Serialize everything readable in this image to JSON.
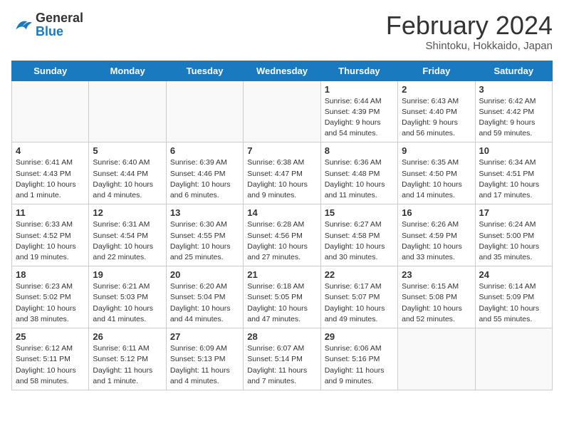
{
  "header": {
    "logo_general": "General",
    "logo_blue": "Blue",
    "main_title": "February 2024",
    "subtitle": "Shintoku, Hokkaido, Japan"
  },
  "calendar": {
    "days_of_week": [
      "Sunday",
      "Monday",
      "Tuesday",
      "Wednesday",
      "Thursday",
      "Friday",
      "Saturday"
    ],
    "weeks": [
      [
        {
          "day": "",
          "content": ""
        },
        {
          "day": "",
          "content": ""
        },
        {
          "day": "",
          "content": ""
        },
        {
          "day": "",
          "content": ""
        },
        {
          "day": "1",
          "content": "Sunrise: 6:44 AM\nSunset: 4:39 PM\nDaylight: 9 hours\nand 54 minutes."
        },
        {
          "day": "2",
          "content": "Sunrise: 6:43 AM\nSunset: 4:40 PM\nDaylight: 9 hours\nand 56 minutes."
        },
        {
          "day": "3",
          "content": "Sunrise: 6:42 AM\nSunset: 4:42 PM\nDaylight: 9 hours\nand 59 minutes."
        }
      ],
      [
        {
          "day": "4",
          "content": "Sunrise: 6:41 AM\nSunset: 4:43 PM\nDaylight: 10 hours\nand 1 minute."
        },
        {
          "day": "5",
          "content": "Sunrise: 6:40 AM\nSunset: 4:44 PM\nDaylight: 10 hours\nand 4 minutes."
        },
        {
          "day": "6",
          "content": "Sunrise: 6:39 AM\nSunset: 4:46 PM\nDaylight: 10 hours\nand 6 minutes."
        },
        {
          "day": "7",
          "content": "Sunrise: 6:38 AM\nSunset: 4:47 PM\nDaylight: 10 hours\nand 9 minutes."
        },
        {
          "day": "8",
          "content": "Sunrise: 6:36 AM\nSunset: 4:48 PM\nDaylight: 10 hours\nand 11 minutes."
        },
        {
          "day": "9",
          "content": "Sunrise: 6:35 AM\nSunset: 4:50 PM\nDaylight: 10 hours\nand 14 minutes."
        },
        {
          "day": "10",
          "content": "Sunrise: 6:34 AM\nSunset: 4:51 PM\nDaylight: 10 hours\nand 17 minutes."
        }
      ],
      [
        {
          "day": "11",
          "content": "Sunrise: 6:33 AM\nSunset: 4:52 PM\nDaylight: 10 hours\nand 19 minutes."
        },
        {
          "day": "12",
          "content": "Sunrise: 6:31 AM\nSunset: 4:54 PM\nDaylight: 10 hours\nand 22 minutes."
        },
        {
          "day": "13",
          "content": "Sunrise: 6:30 AM\nSunset: 4:55 PM\nDaylight: 10 hours\nand 25 minutes."
        },
        {
          "day": "14",
          "content": "Sunrise: 6:28 AM\nSunset: 4:56 PM\nDaylight: 10 hours\nand 27 minutes."
        },
        {
          "day": "15",
          "content": "Sunrise: 6:27 AM\nSunset: 4:58 PM\nDaylight: 10 hours\nand 30 minutes."
        },
        {
          "day": "16",
          "content": "Sunrise: 6:26 AM\nSunset: 4:59 PM\nDaylight: 10 hours\nand 33 minutes."
        },
        {
          "day": "17",
          "content": "Sunrise: 6:24 AM\nSunset: 5:00 PM\nDaylight: 10 hours\nand 35 minutes."
        }
      ],
      [
        {
          "day": "18",
          "content": "Sunrise: 6:23 AM\nSunset: 5:02 PM\nDaylight: 10 hours\nand 38 minutes."
        },
        {
          "day": "19",
          "content": "Sunrise: 6:21 AM\nSunset: 5:03 PM\nDaylight: 10 hours\nand 41 minutes."
        },
        {
          "day": "20",
          "content": "Sunrise: 6:20 AM\nSunset: 5:04 PM\nDaylight: 10 hours\nand 44 minutes."
        },
        {
          "day": "21",
          "content": "Sunrise: 6:18 AM\nSunset: 5:05 PM\nDaylight: 10 hours\nand 47 minutes."
        },
        {
          "day": "22",
          "content": "Sunrise: 6:17 AM\nSunset: 5:07 PM\nDaylight: 10 hours\nand 49 minutes."
        },
        {
          "day": "23",
          "content": "Sunrise: 6:15 AM\nSunset: 5:08 PM\nDaylight: 10 hours\nand 52 minutes."
        },
        {
          "day": "24",
          "content": "Sunrise: 6:14 AM\nSunset: 5:09 PM\nDaylight: 10 hours\nand 55 minutes."
        }
      ],
      [
        {
          "day": "25",
          "content": "Sunrise: 6:12 AM\nSunset: 5:11 PM\nDaylight: 10 hours\nand 58 minutes."
        },
        {
          "day": "26",
          "content": "Sunrise: 6:11 AM\nSunset: 5:12 PM\nDaylight: 11 hours\nand 1 minute."
        },
        {
          "day": "27",
          "content": "Sunrise: 6:09 AM\nSunset: 5:13 PM\nDaylight: 11 hours\nand 4 minutes."
        },
        {
          "day": "28",
          "content": "Sunrise: 6:07 AM\nSunset: 5:14 PM\nDaylight: 11 hours\nand 7 minutes."
        },
        {
          "day": "29",
          "content": "Sunrise: 6:06 AM\nSunset: 5:16 PM\nDaylight: 11 hours\nand 9 minutes."
        },
        {
          "day": "",
          "content": ""
        },
        {
          "day": "",
          "content": ""
        }
      ]
    ]
  }
}
